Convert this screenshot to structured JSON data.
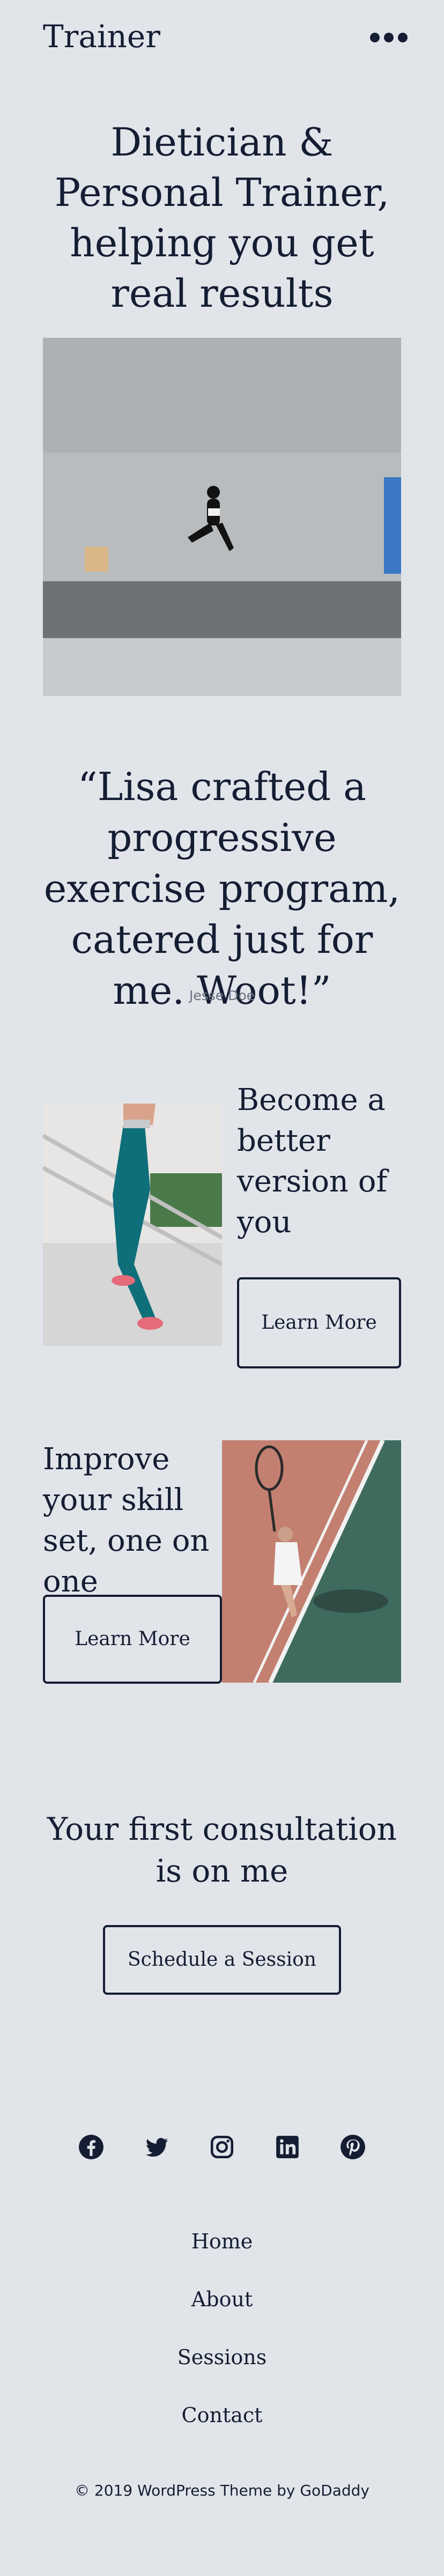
{
  "header": {
    "site_title": "Trainer"
  },
  "hero": {
    "heading": "Dietician & Personal Trainer, helping you get real results"
  },
  "testimonial": {
    "quote": "“Lisa crafted a progressive exercise program, catered just for me. Woot!”",
    "author": "Jesse Doe"
  },
  "feature_1": {
    "title": "Become a better version of you",
    "button_label": "Learn More"
  },
  "feature_2": {
    "title": "Improve your skill set, one on one",
    "button_label": "Learn More"
  },
  "cta": {
    "heading": "Your first consultation is on me",
    "button_label": "Schedule a Session"
  },
  "social": [
    "facebook-icon",
    "twitter-icon",
    "instagram-icon",
    "linkedin-icon",
    "pinterest-icon"
  ],
  "footer_nav": [
    "Home",
    "About",
    "Sessions",
    "Contact"
  ],
  "footer": {
    "copyright": "© 2019  WordPress Theme by GoDaddy"
  },
  "colors": {
    "background": "#e1e5ea",
    "text": "#151d33",
    "muted": "#6b7280"
  }
}
